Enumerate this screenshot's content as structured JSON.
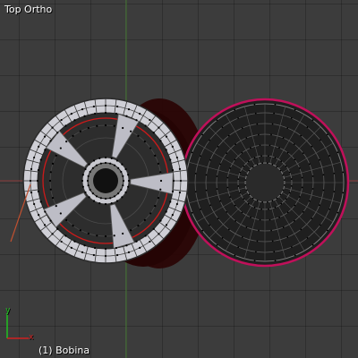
{
  "viewport": {
    "view_label": "Top Ortho",
    "object_label": "(1) Bobina",
    "background_color": "#3c3c3c",
    "grid_color": "#2f2f2f",
    "x_axis_color": "#8b3a3a",
    "y_axis_color": "#4c7f3a"
  },
  "axis_gizmo": {
    "x_label": "x",
    "y_label": "y",
    "x_color": "#d02020",
    "y_color": "#20c020"
  },
  "scene": {
    "left_wheel": {
      "spoke_count": 5,
      "rim_face_color": "#bdbdc6",
      "selection_color": "#cc1a1a",
      "hub_color": "#d0d0d8"
    },
    "right_disc": {
      "face_color": "#1f1f1f",
      "wire_color": "#6e6e6e",
      "outline_color": "#c0105a"
    },
    "shadow_color": "#2a0505"
  }
}
